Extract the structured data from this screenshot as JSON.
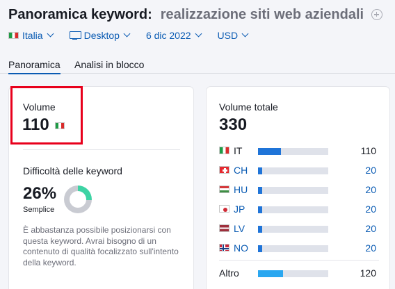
{
  "header": {
    "title": "Panoramica keyword:",
    "keyword": "realizzazione siti web aziendali",
    "add_icon": "plus-circle-icon"
  },
  "filters": {
    "country": "Italia",
    "device": "Desktop",
    "date": "6 dic 2022",
    "currency": "USD",
    "device_icon": "desktop-icon",
    "chevron_icon": "chevron-down-icon"
  },
  "tabs": [
    {
      "label": "Panoramica",
      "active": true
    },
    {
      "label": "Analisi in blocco",
      "active": false
    }
  ],
  "volume": {
    "label": "Volume",
    "value": "110",
    "flag": "flag-it-icon"
  },
  "difficulty": {
    "label": "Difficoltà delle keyword",
    "value": "26%",
    "percent": 26,
    "level": "Semplice",
    "description": "È abbastanza possibile posizionarsi con questa keyword. Avrai bisogno di un contenuto di qualità focalizzato sull'intento della keyword.",
    "color": "#3ed3a4"
  },
  "total_volume": {
    "label": "Volume totale",
    "value": "330",
    "rows": [
      {
        "code": "IT",
        "value": "110",
        "share": 0.33,
        "flag": "flag-it-icon",
        "link": false
      },
      {
        "code": "CH",
        "value": "20",
        "share": 0.06,
        "flag": "flag-ch-icon",
        "link": true
      },
      {
        "code": "HU",
        "value": "20",
        "share": 0.06,
        "flag": "flag-hu-icon",
        "link": true
      },
      {
        "code": "JP",
        "value": "20",
        "share": 0.06,
        "flag": "flag-jp-icon",
        "link": true
      },
      {
        "code": "LV",
        "value": "20",
        "share": 0.06,
        "flag": "flag-lv-icon",
        "link": true
      },
      {
        "code": "NO",
        "value": "20",
        "share": 0.06,
        "flag": "flag-no-icon",
        "link": true
      }
    ],
    "other": {
      "label": "Altro",
      "value": "120",
      "share": 0.36
    }
  },
  "colors": {
    "link": "#0a5bb3",
    "bar_fill": "#1f74d8",
    "bar_track": "#dfe2ea",
    "other_fill": "#2aa7f0",
    "highlight": "#e8001c",
    "donut_track": "#c9cbd2"
  }
}
